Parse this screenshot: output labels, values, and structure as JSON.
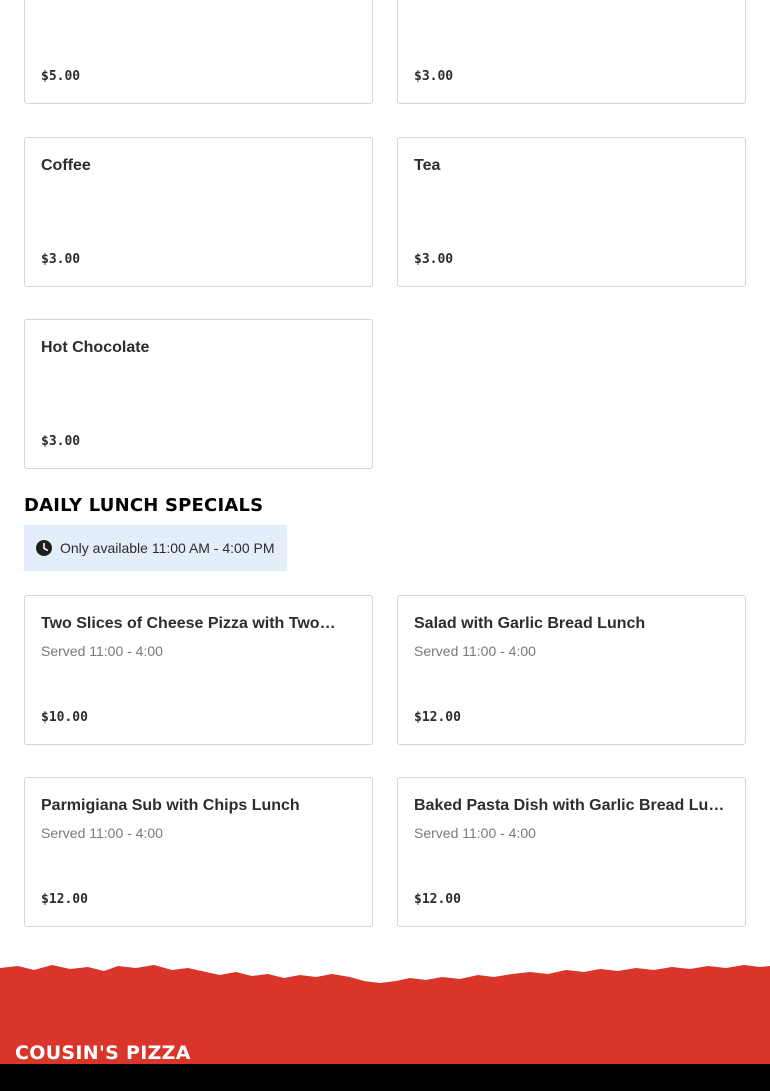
{
  "items_top": [
    {
      "name": "",
      "price": "$5.00"
    },
    {
      "name": "",
      "price": "$3.00"
    },
    {
      "name": "Coffee",
      "price": "$3.00"
    },
    {
      "name": "Tea",
      "price": "$3.00"
    },
    {
      "name": "Hot Chocolate",
      "price": "$3.00"
    }
  ],
  "lunch_section": {
    "title": "DAILY LUNCH SPECIALS",
    "availability": "Only available 11:00 AM - 4:00 PM",
    "items": [
      {
        "name": "Two Slices of Cheese Pizza with Two…",
        "desc": "Served 11:00 - 4:00",
        "price": "$10.00"
      },
      {
        "name": "Salad with Garlic Bread Lunch",
        "desc": "Served 11:00 - 4:00",
        "price": "$12.00"
      },
      {
        "name": "Parmigiana Sub with Chips Lunch",
        "desc": "Served 11:00 - 4:00",
        "price": "$12.00"
      },
      {
        "name": "Baked Pasta Dish with Garlic Bread Lunch",
        "desc": "Served 11:00 - 4:00",
        "price": "$12.00"
      }
    ]
  },
  "footer": {
    "brand": "COUSIN'S PIZZA"
  },
  "colors": {
    "footer_red": "#d9352a",
    "availability_bg": "#e4eefb",
    "card_border": "#d6d6d6"
  },
  "icons": {
    "availability": "clock-icon"
  }
}
